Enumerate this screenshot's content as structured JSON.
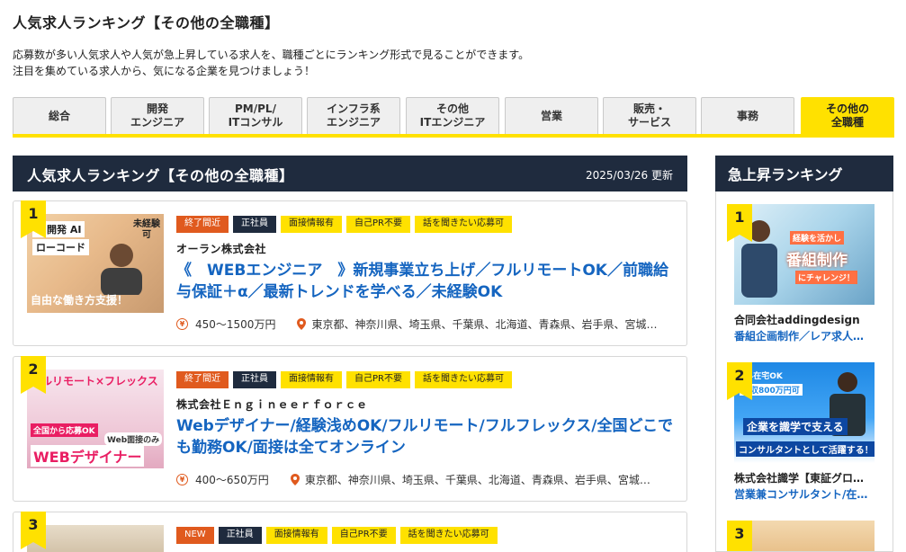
{
  "page": {
    "title": "人気求人ランキング【その他の全職種】",
    "intro_line1": "応募数が多い人気求人や人気が急上昇している求人を、職種ごとにランキング形式で見ることができます。",
    "intro_line2": "注目を集めている求人から、気になる企業を見つけましょう！"
  },
  "tabs": [
    {
      "label": "総合"
    },
    {
      "label": "開発\nエンジニア"
    },
    {
      "label": "PM/PL/\nITコンサル"
    },
    {
      "label": "インフラ系\nエンジニア"
    },
    {
      "label": "その他\nITエンジニア"
    },
    {
      "label": "営業"
    },
    {
      "label": "販売・\nサービス"
    },
    {
      "label": "事務"
    },
    {
      "label": "その他の\n全職種",
      "active": true
    }
  ],
  "main": {
    "header_title": "人気求人ランキング【その他の全職種】",
    "header_date": "2025/03/26 更新",
    "cards": [
      {
        "rank": "1",
        "thumb_text1": "SI開発 AI",
        "thumb_text2": "ローコード",
        "thumb_text3": "未経験可",
        "thumb_text4": "自由な働き方支援！",
        "tags": [
          "終了間近",
          "正社員",
          "面接情報有",
          "自己PR不要",
          "話を聞きたい応募可"
        ],
        "company": "オーラン株式会社",
        "title": "《　WEBエンジニア　》新規事業立ち上げ／フルリモートOK／前職給与保証＋α／最新トレンドを学べる／未経験OK",
        "salary": "450〜1500万円",
        "location": "東京都、神奈川県、埼玉県、千葉県、北海道、青森県、岩手県、宮城…"
      },
      {
        "rank": "2",
        "thumb_text1": "フルリモート×フレックス",
        "thumb_text2": "全国から応募OK",
        "thumb_text3": "Web面接のみ",
        "thumb_text4": "WEBデザイナー",
        "tags": [
          "終了間近",
          "正社員",
          "面接情報有",
          "自己PR不要",
          "話を聞きたい応募可"
        ],
        "company": "株式会社Ｅｎｇｉｎｅｅｒｆｏｒｃｅ",
        "title": "Webデザイナー/経験浅めOK/フルリモート/フルフレックス/全国どこでも勤務OK/面接は全てオンライン",
        "salary": "400〜650万円",
        "location": "東京都、神奈川県、埼玉県、千葉県、北海道、青森県、岩手県、宮城…"
      },
      {
        "rank": "3",
        "tags": [
          "NEW",
          "正社員",
          "面接情報有",
          "自己PR不要",
          "話を聞きたい応募可"
        ]
      }
    ]
  },
  "side": {
    "header_title": "急上昇ランキング",
    "items": [
      {
        "rank": "1",
        "thumb_text1": "経験を活かし",
        "thumb_text2": "番組制作",
        "thumb_text3": "にチャレンジ！",
        "company": "合同会社addingdesign",
        "job": "番組企画制作／レア求人…"
      },
      {
        "rank": "2",
        "thumb_text1": "週4在宅OK",
        "thumb_text2": "年収800万円可",
        "thumb_text3": "企業を識学で支える",
        "thumb_text4": "コンサルタントとして活躍する！",
        "company": "株式会社識学【東証グロ…",
        "job": "営業兼コンサルタント/在…"
      },
      {
        "rank": "3"
      }
    ]
  },
  "colors": {
    "accent": "#ffe100",
    "navy": "#1f2b3e",
    "link": "#1565c0",
    "tag_red": "#e05a1e"
  },
  "icons": {
    "salary": "yen-icon",
    "location": "map-pin-icon"
  }
}
